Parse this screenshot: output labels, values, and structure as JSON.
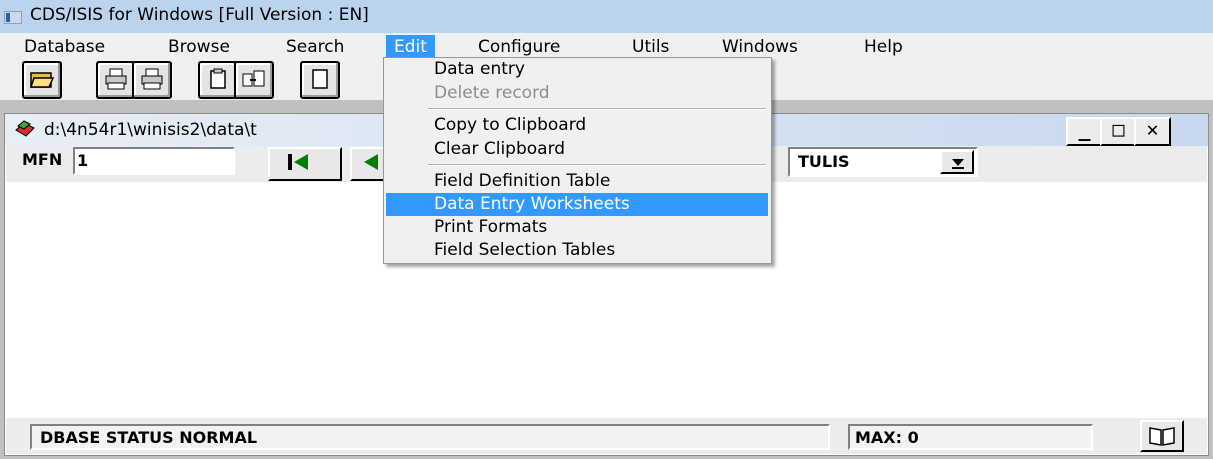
{
  "window": {
    "title": "CDS/ISIS for Windows [Full Version : EN]"
  },
  "menubar": {
    "items": [
      "Database",
      "Browse",
      "Search",
      "Edit",
      "Configure",
      "Utils",
      "Windows",
      "Help"
    ],
    "active": "Edit"
  },
  "toolbar": {
    "buttons": [
      "folder-open-icon",
      "print-txt-icon",
      "print-rtf-icon",
      "clipboard-icon",
      "copy-to-clipboard-icon",
      "document-icon"
    ]
  },
  "child_window": {
    "title": "d:\\4n54r1\\winisis2\\data\\t",
    "mfn_label": "MFN",
    "mfn_value": "1",
    "database_select": "TULIS",
    "controls": [
      "minimize",
      "maximize",
      "close"
    ]
  },
  "statusbar": {
    "status": "DBASE STATUS NORMAL",
    "max": "MAX: 0"
  },
  "edit_menu": {
    "items": [
      {
        "label": "Data entry",
        "enabled": true
      },
      {
        "label": "Delete record",
        "enabled": false
      },
      {
        "label": "Copy to Clipboard",
        "enabled": true
      },
      {
        "label": "Clear Clipboard",
        "enabled": true
      },
      {
        "label": "Field Definition Table",
        "enabled": true
      },
      {
        "label": "Data Entry Worksheets",
        "enabled": true,
        "highlighted": true
      },
      {
        "label": "Print Formats",
        "enabled": true
      },
      {
        "label": "Field Selection Tables",
        "enabled": true
      }
    ]
  },
  "colors": {
    "highlight": "#3399ff",
    "titlebar": "#bcd3ee",
    "mdi_background": "#c0c0c0"
  }
}
